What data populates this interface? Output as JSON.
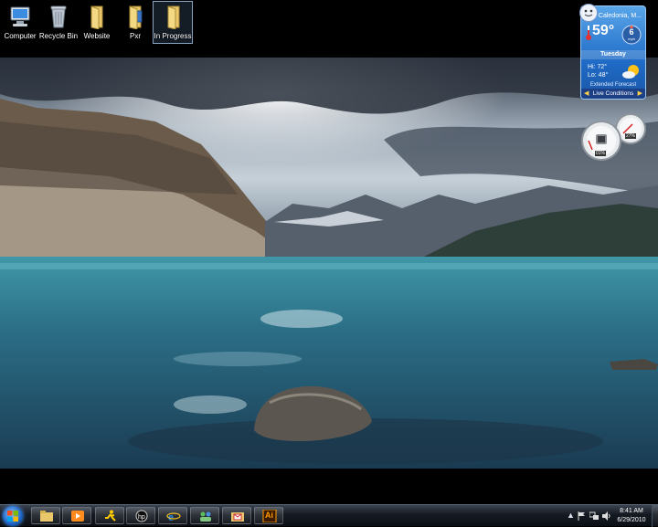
{
  "desktop_icons": [
    {
      "label": "Computer",
      "icon": "computer-icon"
    },
    {
      "label": "Recycle Bin",
      "icon": "recycle-bin-icon"
    },
    {
      "label": "Website",
      "icon": "folder-icon"
    },
    {
      "label": "Pxr",
      "icon": "folder-icon"
    },
    {
      "label": "In Progress",
      "icon": "folder-icon",
      "selected": true
    }
  ],
  "weather": {
    "city": "Caledonia, M...",
    "temperature": "59°",
    "wind_speed": "6",
    "wind_unit": "mph",
    "day": "Tuesday",
    "hi": "Hi: 72°",
    "lo": "Lo: 48°",
    "extended_link": "Extended Forecast",
    "live_label": "Live Conditions",
    "condition_icon": "partly-sunny-icon"
  },
  "cpu_meter": {
    "cpu_percent": "01%",
    "memory_percent": "27%"
  },
  "taskbar": {
    "start_icon": "windows-logo-icon",
    "pinned": [
      {
        "name": "explorer",
        "icon": "folder-icon"
      },
      {
        "name": "media-player",
        "icon": "media-player-icon"
      },
      {
        "name": "messenger",
        "icon": "aim-running-man-icon"
      },
      {
        "name": "hp",
        "icon": "hp-logo-icon"
      },
      {
        "name": "internet-explorer",
        "icon": "ie-icon"
      },
      {
        "name": "contacts",
        "icon": "people-icon"
      },
      {
        "name": "mail-folder",
        "icon": "envelope-folder-icon"
      },
      {
        "name": "illustrator",
        "icon": "illustrator-icon",
        "text": "Ai"
      }
    ],
    "tray_icons": [
      "show-hidden-icon",
      "flag-icon",
      "network-icon",
      "volume-icon"
    ],
    "time": "8:41 AM",
    "date": "6/29/2010"
  },
  "colors": {
    "taskbar": "#151a22",
    "weather_bg": "#1f6bc6",
    "accent": "#1b63c4"
  }
}
